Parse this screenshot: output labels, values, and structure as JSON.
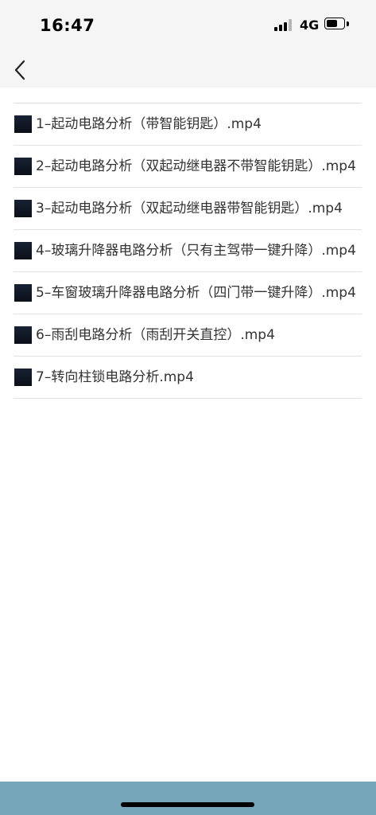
{
  "status_bar": {
    "time": "16:47",
    "network": "4G",
    "battery_level": 0.7
  },
  "nav": {
    "back_icon": "chevron-left-icon"
  },
  "files": [
    {
      "name": "1–起动电路分析（带智能钥匙）.mp4"
    },
    {
      "name": "2–起动电路分析（双起动继电器不带智能钥匙）.mp4"
    },
    {
      "name": "3–起动电路分析（双起动继电器带智能钥匙）.mp4"
    },
    {
      "name": "4–玻璃升降器电路分析（只有主驾带一键升降）.mp4"
    },
    {
      "name": "5–车窗玻璃升降器电路分析（四门带一键升降）.mp4"
    },
    {
      "name": "6–雨刮电路分析（雨刮开关直控）.mp4"
    },
    {
      "name": "7–转向柱锁电路分析.mp4"
    }
  ],
  "colors": {
    "header_bg": "#f5f5f5",
    "divider": "#e2e2e2",
    "bottom_bar": "#76a6b9",
    "thumb": "#131a28"
  }
}
